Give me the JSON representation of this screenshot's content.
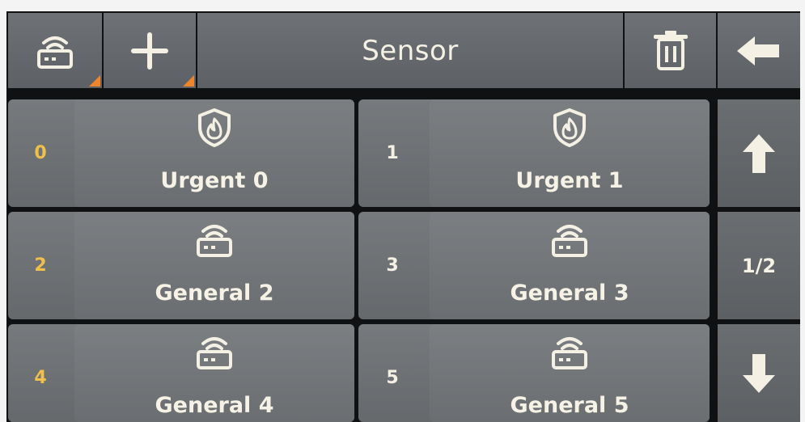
{
  "header": {
    "title": "Sensor",
    "left_buttons": [
      {
        "name": "wireless-sensor-button",
        "icon": "router-wifi-icon"
      },
      {
        "name": "add-button",
        "icon": "plus-icon"
      }
    ],
    "right_buttons": [
      {
        "name": "delete-button",
        "icon": "trash-icon"
      },
      {
        "name": "back-button",
        "icon": "arrow-left-icon"
      }
    ],
    "corner_marker_color": "#f0842a"
  },
  "sensors": [
    {
      "index": "0",
      "label": "Urgent 0",
      "type": "urgent",
      "icon": "shield-flame-icon",
      "index_color": "#f2c04a"
    },
    {
      "index": "1",
      "label": "Urgent 1",
      "type": "urgent",
      "icon": "shield-flame-icon",
      "index_color": "#f4f0e4"
    },
    {
      "index": "2",
      "label": "General 2",
      "type": "general",
      "icon": "router-wifi-icon",
      "index_color": "#f2c04a"
    },
    {
      "index": "3",
      "label": "General 3",
      "type": "general",
      "icon": "router-wifi-icon",
      "index_color": "#f4f0e4"
    },
    {
      "index": "4",
      "label": "General 4",
      "type": "general",
      "icon": "router-wifi-icon",
      "index_color": "#f2c04a"
    },
    {
      "index": "5",
      "label": "General 5",
      "type": "general",
      "icon": "router-wifi-icon",
      "index_color": "#f4f0e4"
    }
  ],
  "pagination": {
    "page_indicator": "1/2",
    "up_icon": "arrow-up-icon",
    "down_icon": "arrow-down-icon"
  }
}
